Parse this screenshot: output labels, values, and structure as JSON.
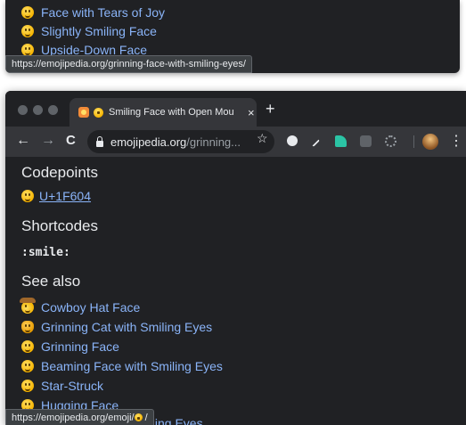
{
  "top_window": {
    "items": [
      {
        "label": "Face with Tears of Joy"
      },
      {
        "label": "Slightly Smiling Face"
      },
      {
        "label": "Upside-Down Face"
      }
    ],
    "status_url": "https://emojipedia.org/grinning-face-with-smiling-eyes/"
  },
  "tab": {
    "title": "Smiling Face with Open Mou",
    "close_glyph": "×",
    "new_tab_glyph": "+"
  },
  "toolbar": {
    "back_glyph": "←",
    "forward_glyph": "→",
    "reload_glyph": "C",
    "url_domain": "emojipedia.org",
    "url_path": "/grinning...",
    "star_glyph": "☆",
    "menu_glyph": "⋮"
  },
  "content": {
    "codepoints_heading": "Codepoints",
    "codepoint": "U+1F604",
    "shortcodes_heading": "Shortcodes",
    "shortcode": ":smile:",
    "see_also_heading": "See also",
    "see_also": [
      {
        "label": "Cowboy Hat Face",
        "icon": "cowboy-hat-face-icon"
      },
      {
        "label": "Grinning Cat with Smiling Eyes",
        "icon": "grinning-cat-icon"
      },
      {
        "label": "Grinning Face",
        "icon": "grinning-face-icon"
      },
      {
        "label": "Beaming Face with Smiling Eyes",
        "icon": "beaming-face-icon"
      },
      {
        "label": "Star-Struck",
        "icon": "star-struck-icon"
      },
      {
        "label": "Hugging Face",
        "icon": "hugging-face-icon"
      }
    ],
    "cut_off_text": "miling Eyes"
  },
  "status_bar": {
    "url_prefix": "https://emojipedia.org/emoji/",
    "url_suffix": " /"
  }
}
